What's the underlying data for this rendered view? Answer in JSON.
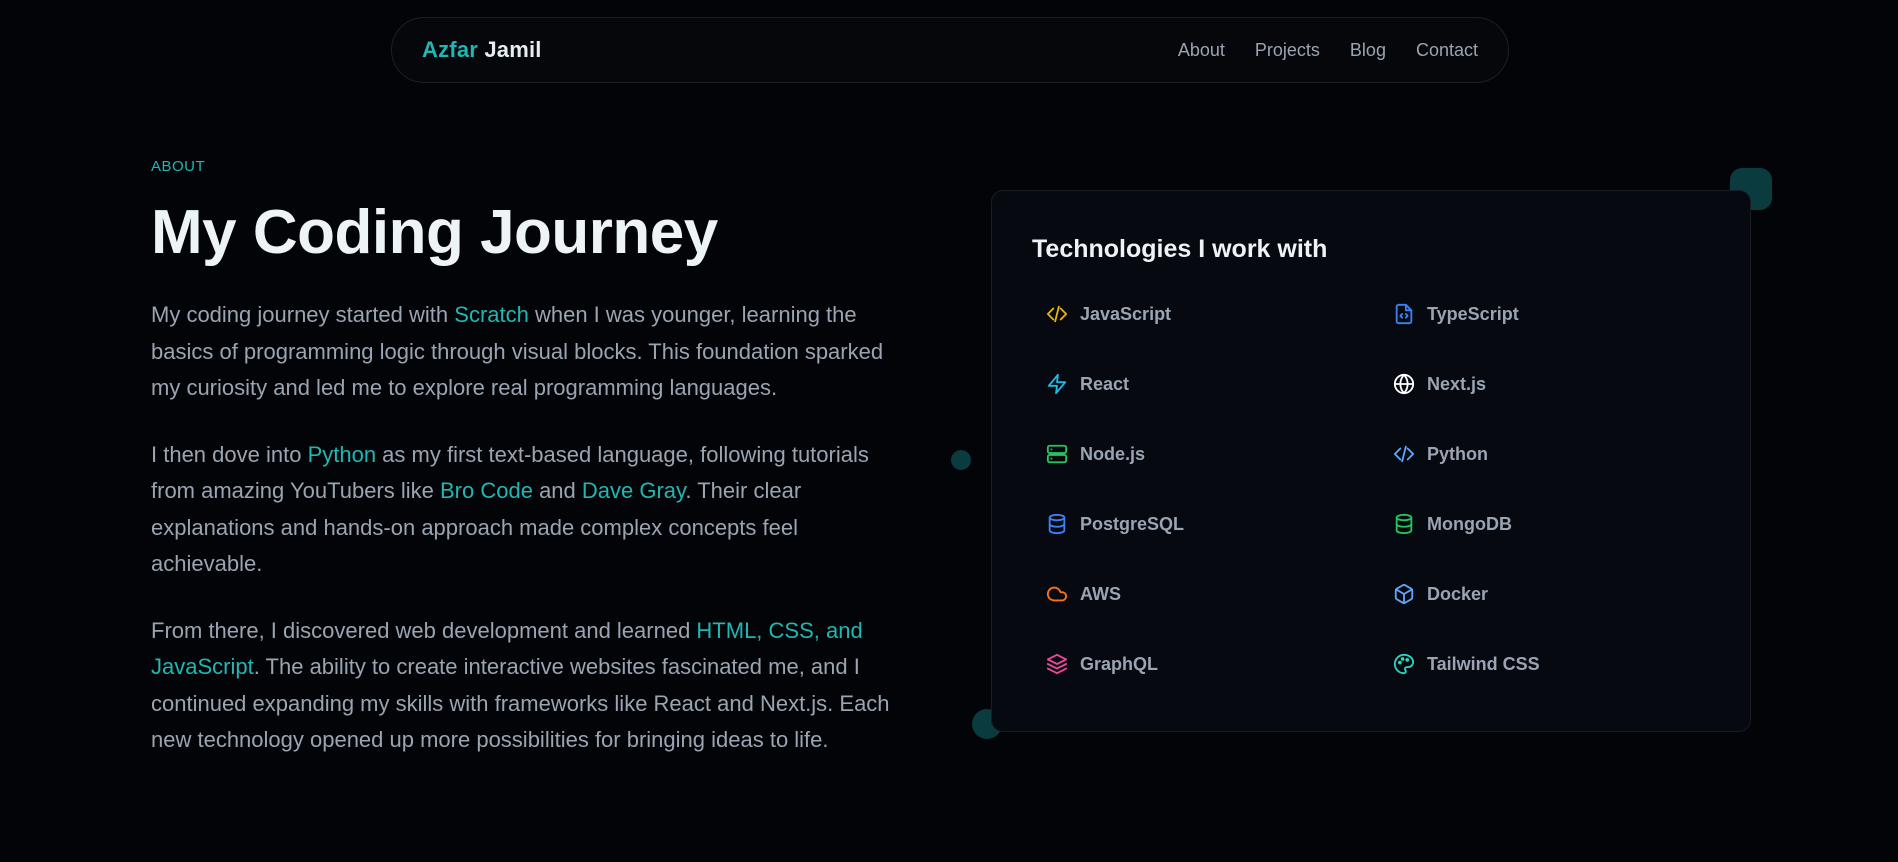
{
  "brand": {
    "first": "Azfar",
    "last": "Jamil"
  },
  "nav": {
    "links": [
      "About",
      "Projects",
      "Blog",
      "Contact"
    ]
  },
  "about": {
    "eyebrow": "ABOUT",
    "title": "My Coding Journey",
    "p1": {
      "t1": "My coding journey started with ",
      "h1": "Scratch",
      "t2": " when I was younger, learning the basics of programming logic through visual blocks. This foundation sparked my curiosity and led me to explore real programming languages."
    },
    "p2": {
      "t1": "I then dove into ",
      "h1": "Python",
      "t2": " as my first text-based language, following tutorials from amazing YouTubers like ",
      "h2": "Bro Code",
      "t3": " and ",
      "h3": "Dave Gray",
      "t4": ". Their clear explanations and hands-on approach made complex concepts feel achievable."
    },
    "p3": {
      "t1": "From there, I discovered web development and learned ",
      "h1": "HTML, CSS, and JavaScript",
      "t2": ". The ability to create interactive websites fascinated me, and I continued expanding my skills with frameworks like React and Next.js. Each new technology opened up more possibilities for bringing ideas to life."
    }
  },
  "tech": {
    "title": "Technologies I work with",
    "items": [
      {
        "name": "JavaScript",
        "icon": "code-icon",
        "color": "#eab308"
      },
      {
        "name": "TypeScript",
        "icon": "file-code-icon",
        "color": "#3b82f6"
      },
      {
        "name": "React",
        "icon": "zap-icon",
        "color": "#22b8e6"
      },
      {
        "name": "Next.js",
        "icon": "globe-icon",
        "color": "#ffffff"
      },
      {
        "name": "Node.js",
        "icon": "server-icon",
        "color": "#22c55e"
      },
      {
        "name": "Python",
        "icon": "code-icon",
        "color": "#60a5fa"
      },
      {
        "name": "PostgreSQL",
        "icon": "database-icon",
        "color": "#3b82f6"
      },
      {
        "name": "MongoDB",
        "icon": "database-icon",
        "color": "#22c55e"
      },
      {
        "name": "AWS",
        "icon": "cloud-icon",
        "color": "#f97316"
      },
      {
        "name": "Docker",
        "icon": "box-icon",
        "color": "#60a5fa"
      },
      {
        "name": "GraphQL",
        "icon": "layers-icon",
        "color": "#ec4899"
      },
      {
        "name": "Tailwind CSS",
        "icon": "palette-icon",
        "color": "#2dd4bf"
      }
    ]
  }
}
